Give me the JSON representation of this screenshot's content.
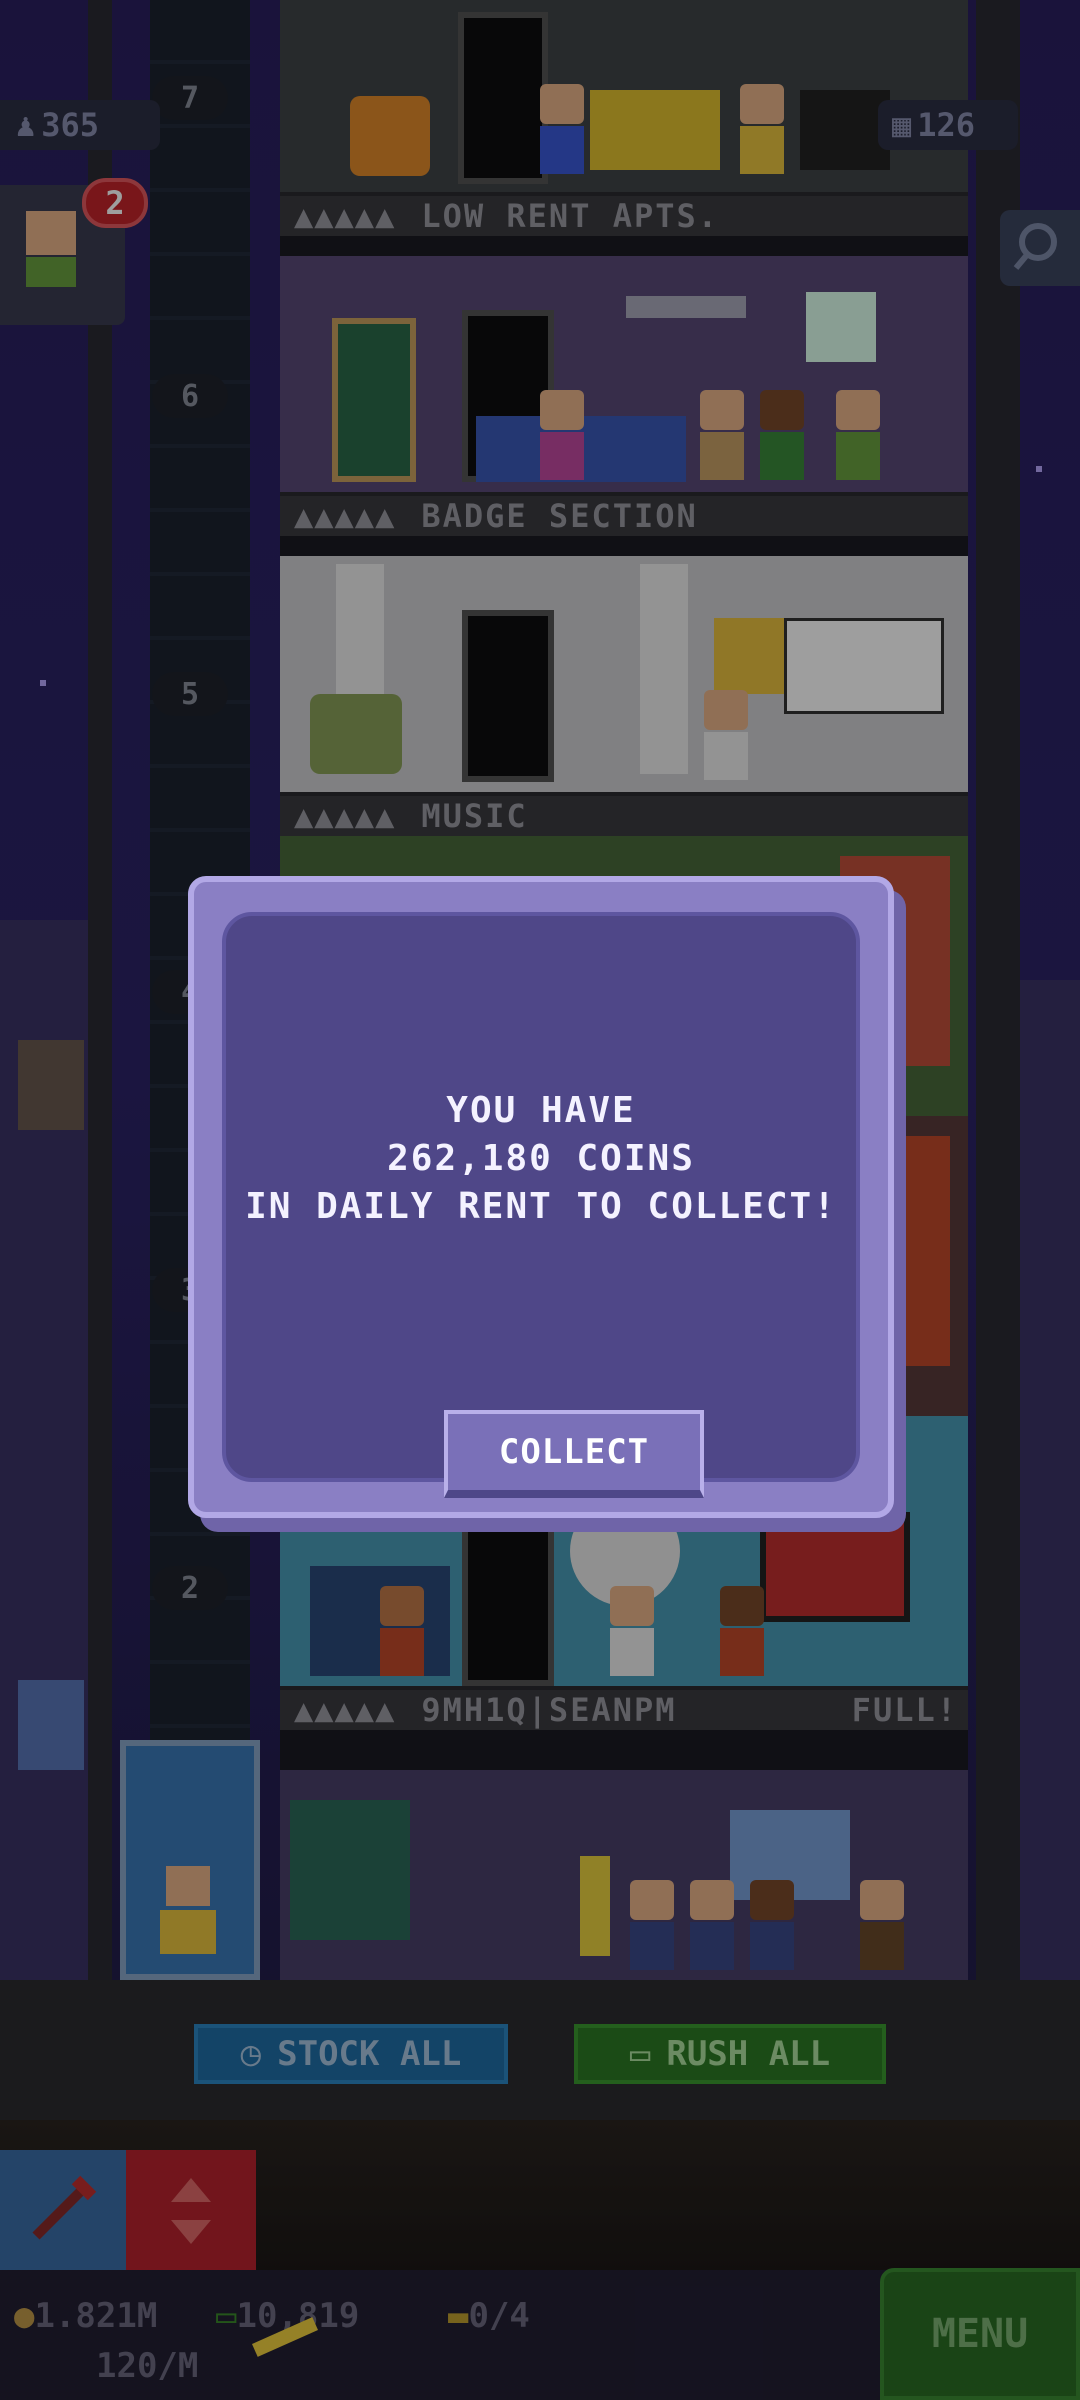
{
  "hud": {
    "population": "365",
    "floors": "126",
    "visitor_count": "2"
  },
  "floors": [
    {
      "number": "7",
      "name": "LOW RENT APTS.",
      "status": ""
    },
    {
      "number": "6",
      "name": "BADGE SECTION",
      "status": ""
    },
    {
      "number": "5",
      "name": "MUSIC",
      "status": ""
    },
    {
      "number": "4",
      "name": "",
      "status": ""
    },
    {
      "number": "3",
      "name": "",
      "status": ""
    },
    {
      "number": "2",
      "name": "9MH1Q|SEANPM",
      "status": "FULL!"
    }
  ],
  "dialog": {
    "line1": "YOU HAVE",
    "line2": "262,180 COINS",
    "line3": "IN DAILY RENT TO COLLECT!",
    "button": "COLLECT"
  },
  "actions": {
    "stock_all": "STOCK ALL",
    "rush_all": "RUSH ALL"
  },
  "status": {
    "coins": "1.821M",
    "bux": "10,819",
    "tickets": "0/4",
    "coins_rate": "120/M",
    "menu": "MENU"
  },
  "colors": {
    "dialog": "#4f4788",
    "stock": "#1f6ea6",
    "rush": "#2c7a24",
    "menu": "#2a6e25"
  }
}
